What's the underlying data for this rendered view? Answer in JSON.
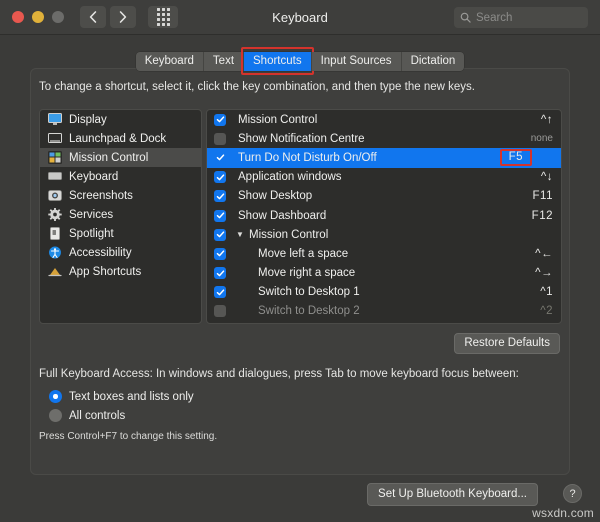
{
  "window": {
    "title": "Keyboard",
    "traffic_lights": [
      "close",
      "minimize",
      "zoom"
    ],
    "back_label": "‹",
    "forward_label": "›",
    "grid_label": "show-all"
  },
  "search": {
    "placeholder": "Search",
    "value": ""
  },
  "tabs": [
    {
      "label": "Keyboard",
      "active": false
    },
    {
      "label": "Text",
      "active": false
    },
    {
      "label": "Shortcuts",
      "active": true,
      "annotated": true
    },
    {
      "label": "Input Sources",
      "active": false
    },
    {
      "label": "Dictation",
      "active": false
    }
  ],
  "instructions": "To change a shortcut, select it, click the key combination, and then type the new keys.",
  "categories": [
    {
      "label": "Display",
      "icon": "display-icon",
      "selected": false
    },
    {
      "label": "Launchpad & Dock",
      "icon": "launchpad-dock-icon",
      "selected": false
    },
    {
      "label": "Mission Control",
      "icon": "mission-control-icon",
      "selected": true
    },
    {
      "label": "Keyboard",
      "icon": "keyboard-icon",
      "selected": false
    },
    {
      "label": "Screenshots",
      "icon": "screenshots-icon",
      "selected": false
    },
    {
      "label": "Services",
      "icon": "services-gear-icon",
      "selected": false
    },
    {
      "label": "Spotlight",
      "icon": "spotlight-icon",
      "selected": false
    },
    {
      "label": "Accessibility",
      "icon": "accessibility-icon",
      "selected": false
    },
    {
      "label": "App Shortcuts",
      "icon": "app-shortcuts-icon",
      "selected": false
    }
  ],
  "shortcuts": [
    {
      "label": "Mission Control",
      "key": "^↑",
      "checked": true,
      "selected": false,
      "level": 0,
      "key_style": "normal"
    },
    {
      "label": "Show Notification Centre",
      "key": "none",
      "checked": false,
      "selected": false,
      "level": 0,
      "key_style": "none"
    },
    {
      "label": "Turn Do Not Disturb On/Off",
      "key": "F5",
      "checked": true,
      "selected": true,
      "level": 0,
      "key_style": "boxed"
    },
    {
      "label": "Application windows",
      "key": "^↓",
      "checked": true,
      "selected": false,
      "level": 0,
      "key_style": "normal"
    },
    {
      "label": "Show Desktop",
      "key": "F11",
      "checked": true,
      "selected": false,
      "level": 0,
      "key_style": "normal"
    },
    {
      "label": "Show Dashboard",
      "key": "F12",
      "checked": true,
      "selected": false,
      "level": 0,
      "key_style": "normal"
    },
    {
      "label": "Mission Control",
      "key": "",
      "checked": true,
      "selected": false,
      "level": 0,
      "group": true,
      "disclosure": "▼",
      "key_style": "normal"
    },
    {
      "label": "Move left a space",
      "key": "^←",
      "checked": true,
      "selected": false,
      "level": 1,
      "key_style": "normal"
    },
    {
      "label": "Move right a space",
      "key": "^→",
      "checked": true,
      "selected": false,
      "level": 1,
      "key_style": "normal"
    },
    {
      "label": "Switch to Desktop 1",
      "key": "^1",
      "checked": true,
      "selected": false,
      "level": 1,
      "key_style": "normal"
    },
    {
      "label": "Switch to Desktop 2",
      "key": "^2",
      "checked": false,
      "selected": false,
      "level": 1,
      "key_style": "dim",
      "dim": true
    }
  ],
  "restore_defaults_label": "Restore Defaults",
  "full_keyboard_access": {
    "label": "Full Keyboard Access: In windows and dialogues, press Tab to move keyboard focus between:",
    "options": [
      {
        "label": "Text boxes and lists only",
        "selected": true
      },
      {
        "label": "All controls",
        "selected": false
      }
    ],
    "hint": "Press Control+F7 to change this setting."
  },
  "footer": {
    "bluetooth_button": "Set Up Bluetooth Keyboard...",
    "help_button": "?"
  },
  "watermark": "wsxdn.com",
  "colors": {
    "accent_blue": "#1176ee",
    "annotation_red": "#d4332c",
    "window_bg": "#3b3b39",
    "list_bg": "#2d2d2b"
  }
}
